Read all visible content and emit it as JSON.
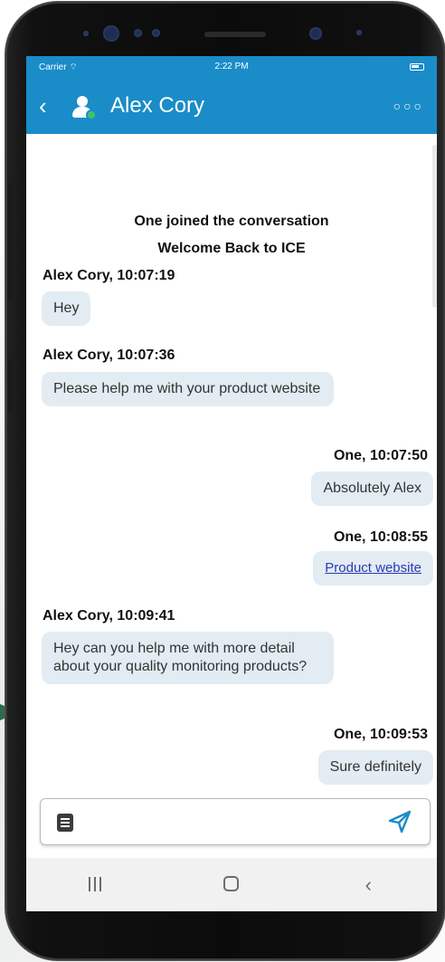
{
  "status_bar": {
    "carrier": "Carrier",
    "time": "2:22 PM"
  },
  "header": {
    "back_icon": "chevron-left-icon",
    "contact_name": "Alex Cory",
    "more_icon": "more-horizontal-icon"
  },
  "system_messages": [
    "One joined the conversation",
    "Welcome Back to ICE"
  ],
  "messages": [
    {
      "sender": "Alex Cory, 10:07:19",
      "text": "Hey",
      "direction": "incoming"
    },
    {
      "sender": "Alex Cory, 10:07:36",
      "text": "Please help me with your product website",
      "direction": "incoming"
    },
    {
      "sender": "One, 10:07:50",
      "text": "Absolutely Alex",
      "direction": "outgoing"
    },
    {
      "sender": "One, 10:08:55",
      "text": "Product website",
      "direction": "outgoing",
      "is_link": true
    },
    {
      "sender": "Alex Cory, 10:09:41",
      "text": "Hey can you help me with more detail about your quality monitoring products?",
      "direction": "incoming"
    },
    {
      "sender": "One, 10:09:53",
      "text": "Sure definitely",
      "direction": "outgoing"
    }
  ],
  "composer": {
    "value": "",
    "attach_icon": "document-icon",
    "send_icon": "send-icon"
  },
  "nav_bar": {
    "recent_icon": "recent-apps-icon",
    "home_icon": "home-icon",
    "back_icon": "back-icon"
  },
  "colors": {
    "header": "#1a8cc8",
    "bubble": "#e2ecf2",
    "presence": "#3cc36a",
    "link": "#2b38b8"
  }
}
